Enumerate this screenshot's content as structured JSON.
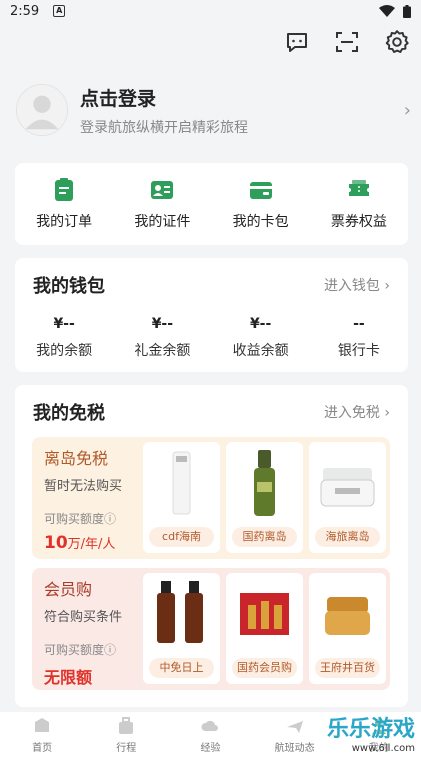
{
  "status": {
    "time": "2:59"
  },
  "profile": {
    "name": "点击登录",
    "sub": "登录航旅纵横开启精彩旅程"
  },
  "quick": [
    {
      "label": "我的订单",
      "icon": "order-icon"
    },
    {
      "label": "我的证件",
      "icon": "id-card-icon"
    },
    {
      "label": "我的卡包",
      "icon": "wallet-card-icon"
    },
    {
      "label": "票券权益",
      "icon": "ticket-icon"
    }
  ],
  "wallet": {
    "title": "我的钱包",
    "link": "进入钱包 ›",
    "items": [
      {
        "value": "¥--",
        "label": "我的余额"
      },
      {
        "value": "¥--",
        "label": "礼金余额"
      },
      {
        "value": "¥--",
        "label": "收益余额"
      },
      {
        "value": "--",
        "label": "银行卡"
      }
    ]
  },
  "dutyfree": {
    "title": "我的免税",
    "link": "进入免税 ›",
    "panel1": {
      "title": "离岛免税",
      "sub": "暂时无法购买",
      "quota_label": "可购买额度ⓘ",
      "quota_value": "10",
      "quota_unit": "万/年/人",
      "products": [
        "cdf海南",
        "国药离岛",
        "海旅离岛"
      ]
    },
    "panel2": {
      "title": "会员购",
      "sub": "符合购买条件",
      "quota_label": "可购买额度ⓘ",
      "quota_value": "无限额",
      "products": [
        "中免日上",
        "国药会员购",
        "王府井百货"
      ]
    }
  },
  "tabs": [
    {
      "label": "首页",
      "icon": "home-icon"
    },
    {
      "label": "行程",
      "icon": "luggage-icon"
    },
    {
      "label": "经验",
      "icon": "cloud-icon"
    },
    {
      "label": "航班动态",
      "icon": "plane-icon"
    },
    {
      "label": "我的",
      "icon": "user-icon"
    }
  ],
  "watermark": {
    "text": "乐乐游戏",
    "url": "www.6ll.com"
  },
  "colors": {
    "accent": "#2e9e5b",
    "price": "#e0322a"
  }
}
